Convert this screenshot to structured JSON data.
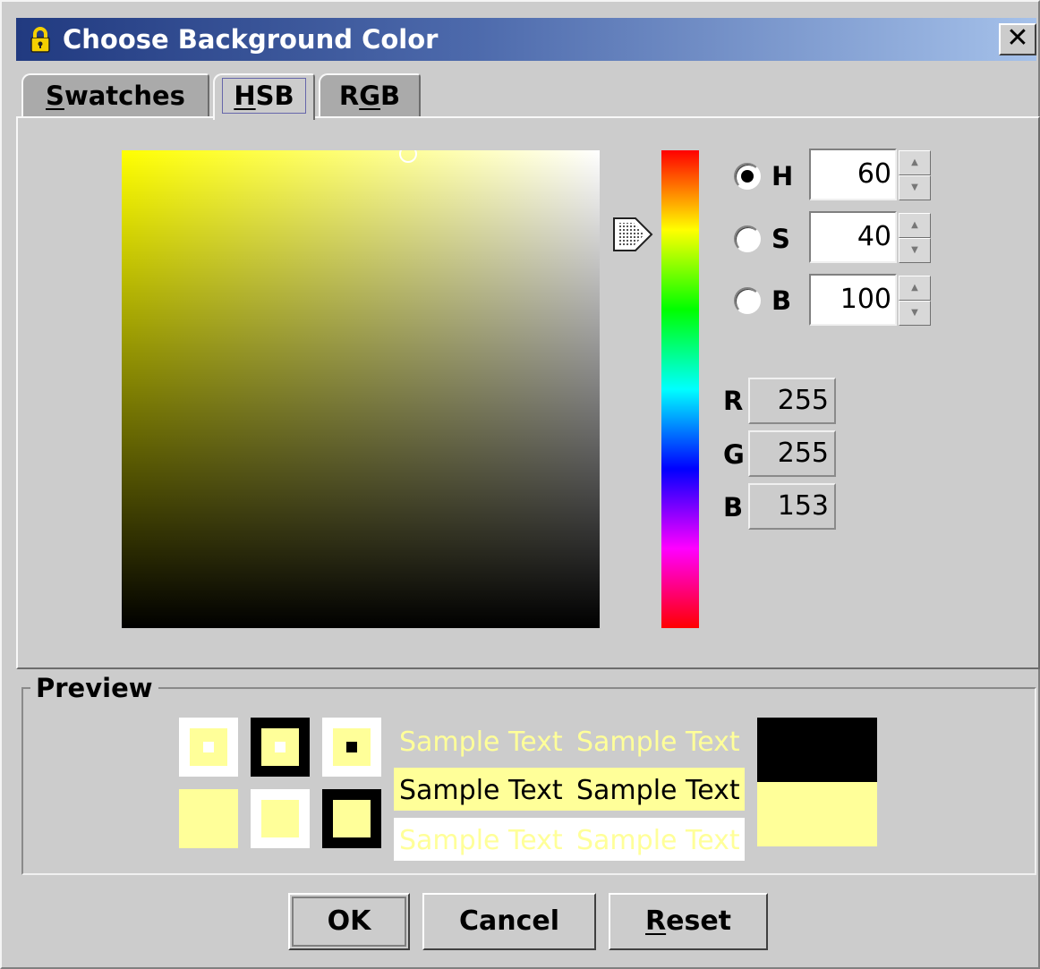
{
  "window": {
    "title": "Choose Background Color",
    "close_label": "✕"
  },
  "tabs": [
    {
      "label": "Swatches",
      "mnemonic": "S",
      "rest": "watches",
      "active": false
    },
    {
      "label": "HSB",
      "mnemonic": "H",
      "rest": "SB",
      "active": true
    },
    {
      "label": "RGB",
      "pre": "R",
      "mnemonic": "G",
      "rest": "B",
      "active": false
    }
  ],
  "hsb": {
    "h": {
      "label": "H",
      "value": "60",
      "selected": true
    },
    "s": {
      "label": "S",
      "value": "40",
      "selected": false
    },
    "b": {
      "label": "B",
      "value": "100",
      "selected": false
    }
  },
  "rgb_readout": {
    "r": {
      "label": "R",
      "value": "255"
    },
    "g": {
      "label": "G",
      "value": "255"
    },
    "b": {
      "label": "B",
      "value": "153"
    }
  },
  "preview": {
    "title": "Preview",
    "sample_text": "Sample Text",
    "selected_color": "#ffff99"
  },
  "buttons": {
    "ok": "OK",
    "cancel": "Cancel",
    "reset": {
      "label": "Reset",
      "mnemonic": "R",
      "rest": "eset"
    }
  }
}
